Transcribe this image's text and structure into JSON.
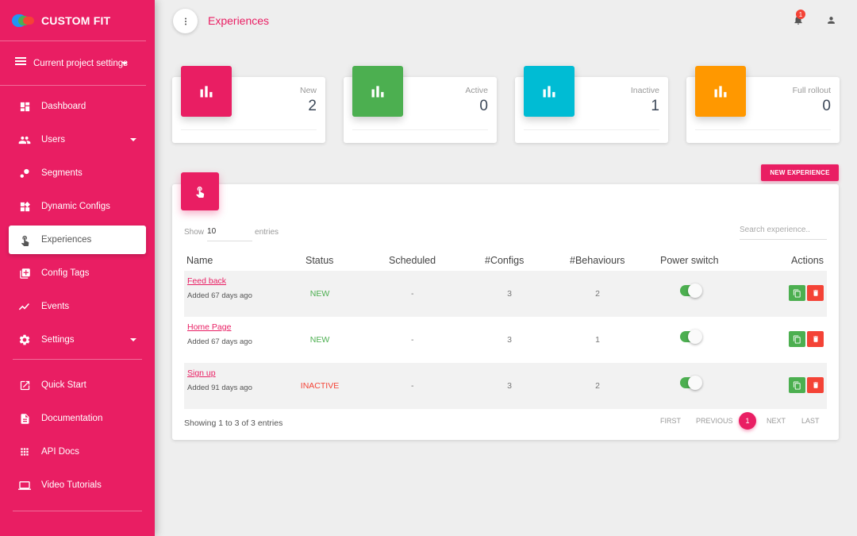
{
  "app": {
    "name": "CUSTOM FIT"
  },
  "sidebar": {
    "project_settings": "Current project settings",
    "items": [
      {
        "label": "Dashboard",
        "icon": "dashboard-icon"
      },
      {
        "label": "Users",
        "icon": "users-icon"
      },
      {
        "label": "Segments",
        "icon": "segments-icon"
      },
      {
        "label": "Dynamic Configs",
        "icon": "widgets-icon"
      },
      {
        "label": "Experiences",
        "icon": "touch-icon",
        "active": true
      },
      {
        "label": "Config Tags",
        "icon": "add-box-icon"
      },
      {
        "label": "Events",
        "icon": "timeline-icon"
      },
      {
        "label": "Settings",
        "icon": "gear-icon"
      }
    ],
    "help_items": [
      {
        "label": "Quick Start",
        "icon": "open-in-new-icon"
      },
      {
        "label": "Documentation",
        "icon": "document-icon"
      },
      {
        "label": "API Docs",
        "icon": "apps-icon"
      },
      {
        "label": "Video Tutorials",
        "icon": "monitor-icon"
      }
    ]
  },
  "header": {
    "title": "Experiences",
    "notification_count": "1"
  },
  "stats": [
    {
      "label": "New",
      "value": "2",
      "color": "#e91e63"
    },
    {
      "label": "Active",
      "value": "0",
      "color": "#4caf50"
    },
    {
      "label": "Inactive",
      "value": "1",
      "color": "#00bcd4"
    },
    {
      "label": "Full rollout",
      "value": "0",
      "color": "#ff9800"
    }
  ],
  "new_experience_button": "NEW EXPERIENCE",
  "table": {
    "show_label": "Show",
    "show_value": "10",
    "entries_label": "entries",
    "search_placeholder": "Search experience..",
    "columns": [
      "Name",
      "Status",
      "Scheduled",
      "#Configs",
      "#Behaviours",
      "Power switch",
      "Actions"
    ],
    "rows": [
      {
        "name": "Feed back",
        "added": "Added 67 days ago",
        "status": "NEW",
        "scheduled": "-",
        "configs": "3",
        "behaviours": "2",
        "power": true
      },
      {
        "name": "Home Page",
        "added": "Added 67 days ago",
        "status": "NEW",
        "scheduled": "-",
        "configs": "3",
        "behaviours": "1",
        "power": true
      },
      {
        "name": "Sign up",
        "added": "Added 91 days ago",
        "status": "INACTIVE",
        "scheduled": "-",
        "configs": "3",
        "behaviours": "2",
        "power": true
      }
    ],
    "info": "Showing 1 to 3 of 3 entries",
    "pagination": {
      "first": "FIRST",
      "previous": "PREVIOUS",
      "current": "1",
      "next": "NEXT",
      "last": "LAST"
    }
  }
}
